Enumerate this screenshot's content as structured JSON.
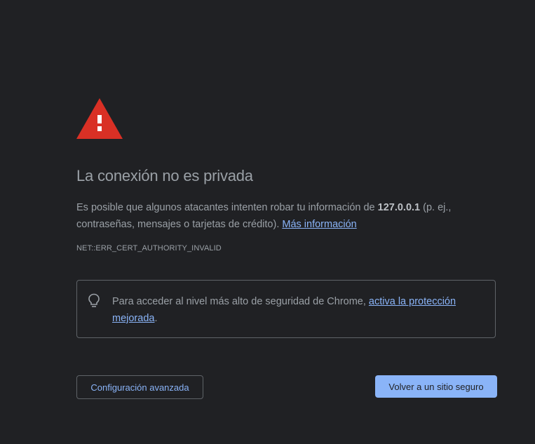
{
  "icons": {
    "warning": "warning-triangle-icon",
    "bulb": "lightbulb-icon"
  },
  "colors": {
    "background": "#202124",
    "warning_red": "#d93025",
    "link_blue": "#8ab4f8",
    "text": "#9aa0a6"
  },
  "heading": "La conexión no es privada",
  "main_message": {
    "part1": "Es posible que algunos atacantes intenten robar tu información de ",
    "host": "127.0.0.1",
    "part2": " (p. ej., contraseñas, mensajes o tarjetas de crédito). ",
    "learn_more": "Más información"
  },
  "error_code": "NET::ERR_CERT_AUTHORITY_INVALID",
  "enhanced_protection": {
    "text": "Para acceder al nivel más alto de seguridad de Chrome, ",
    "link": "activa la protección mejorada",
    "suffix": "."
  },
  "buttons": {
    "advanced": "Configuración avanzada",
    "back_to_safety": "Volver a un sitio seguro"
  }
}
